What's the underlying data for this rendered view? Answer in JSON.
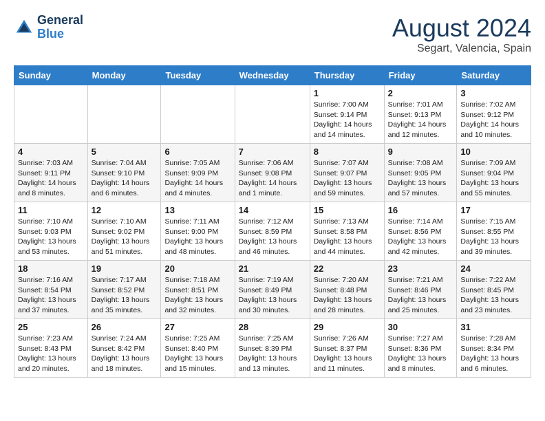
{
  "header": {
    "logo_line1": "General",
    "logo_line2": "Blue",
    "month": "August 2024",
    "location": "Segart, Valencia, Spain"
  },
  "weekdays": [
    "Sunday",
    "Monday",
    "Tuesday",
    "Wednesday",
    "Thursday",
    "Friday",
    "Saturday"
  ],
  "weeks": [
    [
      {
        "day": "",
        "info": ""
      },
      {
        "day": "",
        "info": ""
      },
      {
        "day": "",
        "info": ""
      },
      {
        "day": "",
        "info": ""
      },
      {
        "day": "1",
        "info": "Sunrise: 7:00 AM\nSunset: 9:14 PM\nDaylight: 14 hours\nand 14 minutes."
      },
      {
        "day": "2",
        "info": "Sunrise: 7:01 AM\nSunset: 9:13 PM\nDaylight: 14 hours\nand 12 minutes."
      },
      {
        "day": "3",
        "info": "Sunrise: 7:02 AM\nSunset: 9:12 PM\nDaylight: 14 hours\nand 10 minutes."
      }
    ],
    [
      {
        "day": "4",
        "info": "Sunrise: 7:03 AM\nSunset: 9:11 PM\nDaylight: 14 hours\nand 8 minutes."
      },
      {
        "day": "5",
        "info": "Sunrise: 7:04 AM\nSunset: 9:10 PM\nDaylight: 14 hours\nand 6 minutes."
      },
      {
        "day": "6",
        "info": "Sunrise: 7:05 AM\nSunset: 9:09 PM\nDaylight: 14 hours\nand 4 minutes."
      },
      {
        "day": "7",
        "info": "Sunrise: 7:06 AM\nSunset: 9:08 PM\nDaylight: 14 hours\nand 1 minute."
      },
      {
        "day": "8",
        "info": "Sunrise: 7:07 AM\nSunset: 9:07 PM\nDaylight: 13 hours\nand 59 minutes."
      },
      {
        "day": "9",
        "info": "Sunrise: 7:08 AM\nSunset: 9:05 PM\nDaylight: 13 hours\nand 57 minutes."
      },
      {
        "day": "10",
        "info": "Sunrise: 7:09 AM\nSunset: 9:04 PM\nDaylight: 13 hours\nand 55 minutes."
      }
    ],
    [
      {
        "day": "11",
        "info": "Sunrise: 7:10 AM\nSunset: 9:03 PM\nDaylight: 13 hours\nand 53 minutes."
      },
      {
        "day": "12",
        "info": "Sunrise: 7:10 AM\nSunset: 9:02 PM\nDaylight: 13 hours\nand 51 minutes."
      },
      {
        "day": "13",
        "info": "Sunrise: 7:11 AM\nSunset: 9:00 PM\nDaylight: 13 hours\nand 48 minutes."
      },
      {
        "day": "14",
        "info": "Sunrise: 7:12 AM\nSunset: 8:59 PM\nDaylight: 13 hours\nand 46 minutes."
      },
      {
        "day": "15",
        "info": "Sunrise: 7:13 AM\nSunset: 8:58 PM\nDaylight: 13 hours\nand 44 minutes."
      },
      {
        "day": "16",
        "info": "Sunrise: 7:14 AM\nSunset: 8:56 PM\nDaylight: 13 hours\nand 42 minutes."
      },
      {
        "day": "17",
        "info": "Sunrise: 7:15 AM\nSunset: 8:55 PM\nDaylight: 13 hours\nand 39 minutes."
      }
    ],
    [
      {
        "day": "18",
        "info": "Sunrise: 7:16 AM\nSunset: 8:54 PM\nDaylight: 13 hours\nand 37 minutes."
      },
      {
        "day": "19",
        "info": "Sunrise: 7:17 AM\nSunset: 8:52 PM\nDaylight: 13 hours\nand 35 minutes."
      },
      {
        "day": "20",
        "info": "Sunrise: 7:18 AM\nSunset: 8:51 PM\nDaylight: 13 hours\nand 32 minutes."
      },
      {
        "day": "21",
        "info": "Sunrise: 7:19 AM\nSunset: 8:49 PM\nDaylight: 13 hours\nand 30 minutes."
      },
      {
        "day": "22",
        "info": "Sunrise: 7:20 AM\nSunset: 8:48 PM\nDaylight: 13 hours\nand 28 minutes."
      },
      {
        "day": "23",
        "info": "Sunrise: 7:21 AM\nSunset: 8:46 PM\nDaylight: 13 hours\nand 25 minutes."
      },
      {
        "day": "24",
        "info": "Sunrise: 7:22 AM\nSunset: 8:45 PM\nDaylight: 13 hours\nand 23 minutes."
      }
    ],
    [
      {
        "day": "25",
        "info": "Sunrise: 7:23 AM\nSunset: 8:43 PM\nDaylight: 13 hours\nand 20 minutes."
      },
      {
        "day": "26",
        "info": "Sunrise: 7:24 AM\nSunset: 8:42 PM\nDaylight: 13 hours\nand 18 minutes."
      },
      {
        "day": "27",
        "info": "Sunrise: 7:25 AM\nSunset: 8:40 PM\nDaylight: 13 hours\nand 15 minutes."
      },
      {
        "day": "28",
        "info": "Sunrise: 7:25 AM\nSunset: 8:39 PM\nDaylight: 13 hours\nand 13 minutes."
      },
      {
        "day": "29",
        "info": "Sunrise: 7:26 AM\nSunset: 8:37 PM\nDaylight: 13 hours\nand 11 minutes."
      },
      {
        "day": "30",
        "info": "Sunrise: 7:27 AM\nSunset: 8:36 PM\nDaylight: 13 hours\nand 8 minutes."
      },
      {
        "day": "31",
        "info": "Sunrise: 7:28 AM\nSunset: 8:34 PM\nDaylight: 13 hours\nand 6 minutes."
      }
    ]
  ]
}
